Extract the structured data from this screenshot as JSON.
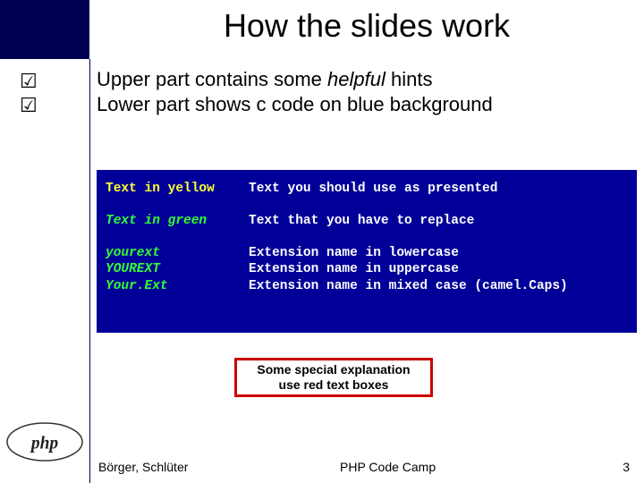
{
  "title": "How the slides work",
  "bullets": {
    "glyph": "☑"
  },
  "hints": {
    "line1_pre": "Upper part contains some ",
    "line1_em": "helpful",
    "line1_post": " hints",
    "line2": "Lower part shows c code on blue background"
  },
  "code": {
    "row1": {
      "left": "Text in yellow",
      "right": "Text you should use as presented"
    },
    "row2": {
      "left": "Text in green",
      "right": "Text that you have to replace"
    },
    "row3": {
      "l1": "yourext",
      "l2": "YOUREXT",
      "l3": "Your.Ext",
      "r1": "Extension name in lowercase",
      "r2": "Extension name in uppercase",
      "r3": "Extension name in mixed case (camel.Caps)"
    }
  },
  "redbox": {
    "line1": "Some special explanation",
    "line2": "use red text boxes"
  },
  "footer": {
    "authors": "Börger, Schlüter",
    "camp": "PHP Code Camp",
    "page": "3"
  }
}
